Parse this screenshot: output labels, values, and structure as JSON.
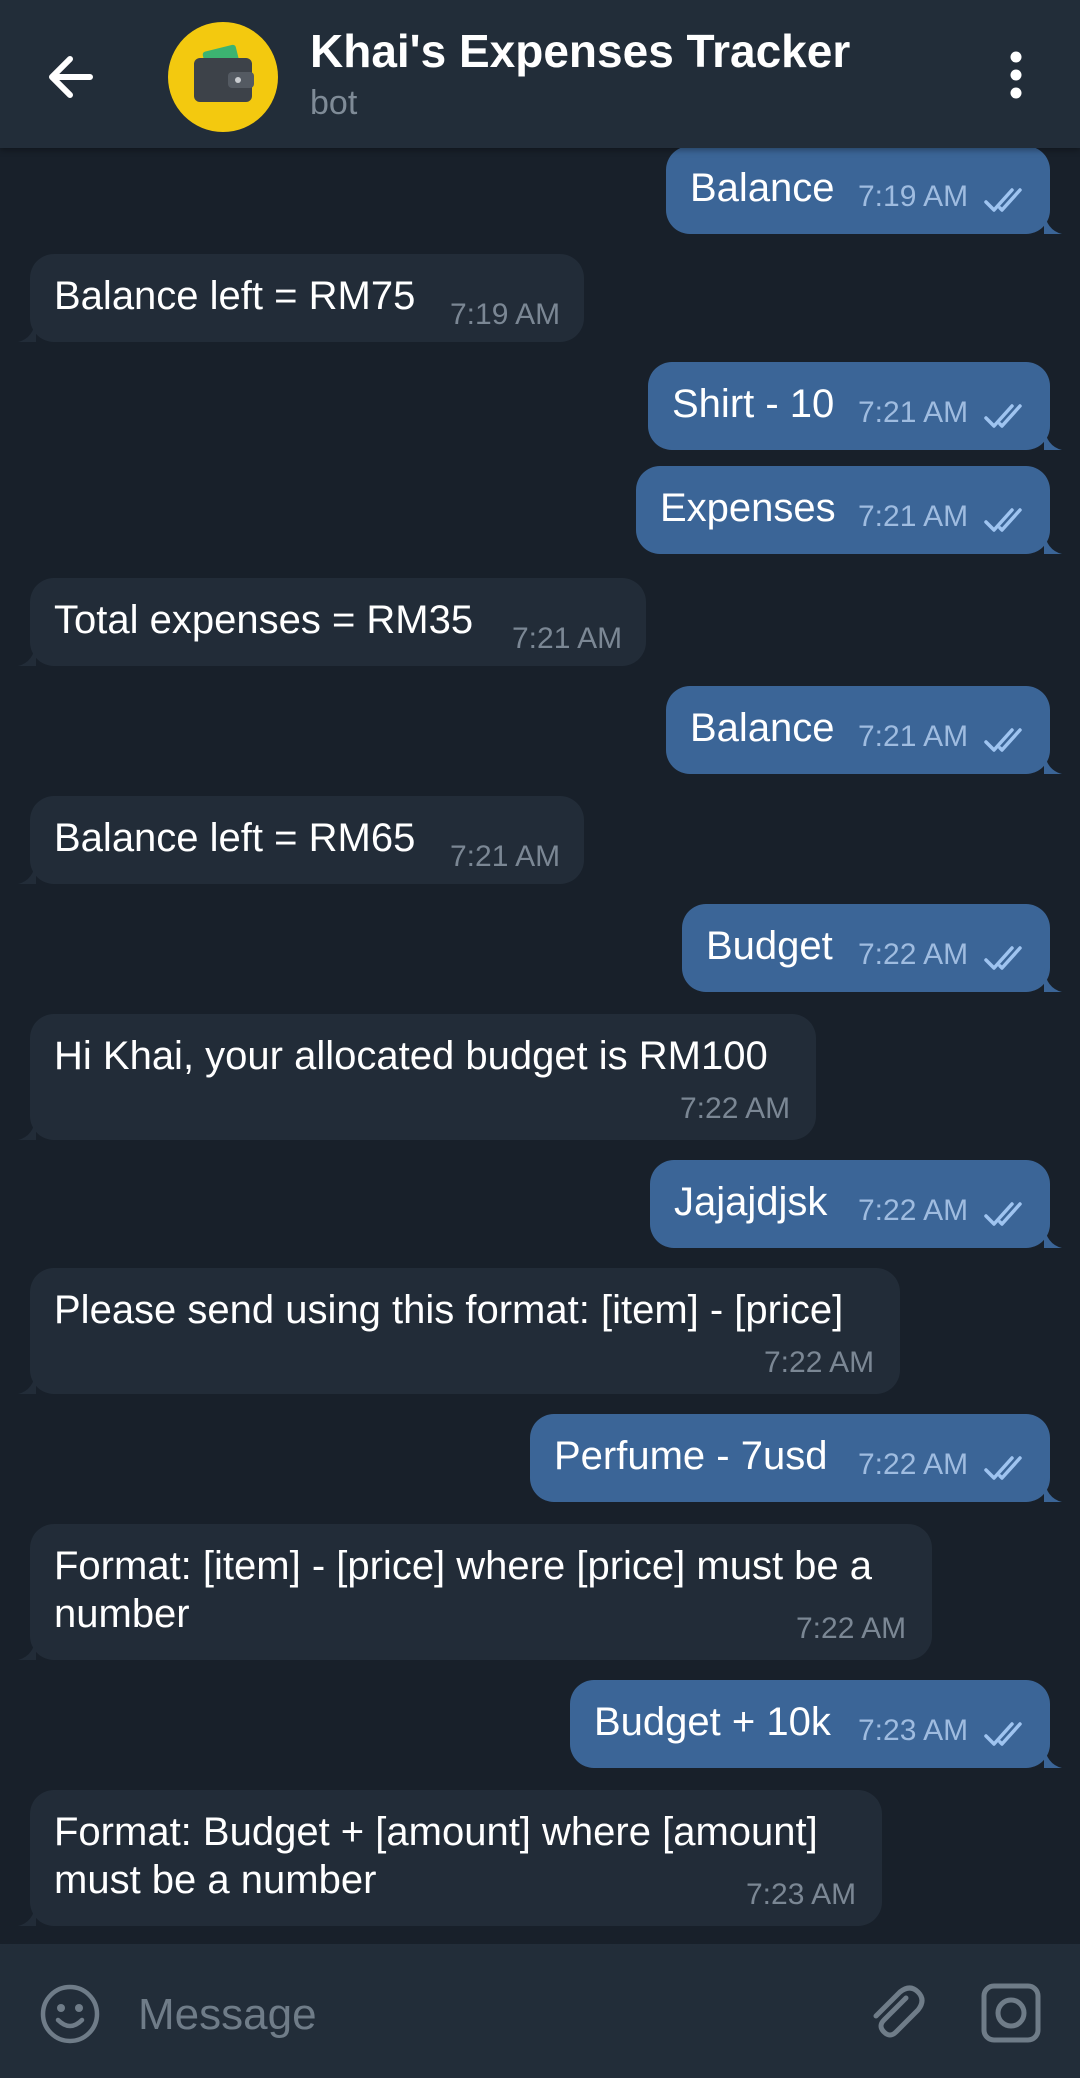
{
  "header": {
    "title": "Khai's Expenses Tracker",
    "subtitle": "bot",
    "back_icon": "arrow-left-icon",
    "avatar_icon": "wallet-icon",
    "menu_icon": "more-vertical-icon"
  },
  "messages": [
    {
      "dir": "out",
      "text": "Balance",
      "time": "7:19 AM"
    },
    {
      "dir": "in",
      "text": "Balance left = RM75",
      "time": "7:19 AM"
    },
    {
      "dir": "out",
      "text": "Shirt - 10",
      "time": "7:21 AM"
    },
    {
      "dir": "out",
      "text": "Expenses",
      "time": "7:21 AM"
    },
    {
      "dir": "in",
      "text": "Total expenses = RM35",
      "time": "7:21 AM"
    },
    {
      "dir": "out",
      "text": "Balance",
      "time": "7:21 AM"
    },
    {
      "dir": "in",
      "text": "Balance left = RM65",
      "time": "7:21 AM"
    },
    {
      "dir": "out",
      "text": "Budget",
      "time": "7:22 AM"
    },
    {
      "dir": "in",
      "text": "Hi Khai, your allocated budget is RM100",
      "time": "7:22 AM"
    },
    {
      "dir": "out",
      "text": "Jajajdjsk",
      "time": "7:22 AM"
    },
    {
      "dir": "in",
      "text": "Please send using this format: [item] - [price]",
      "time": "7:22 AM"
    },
    {
      "dir": "out",
      "text": "Perfume - 7usd",
      "time": "7:22 AM"
    },
    {
      "dir": "in",
      "text": "Format: [item] - [price] where [price] must be a number",
      "time": "7:22 AM"
    },
    {
      "dir": "out",
      "text": "Budget + 10k",
      "time": "7:23 AM"
    },
    {
      "dir": "in",
      "text": "Format: Budget + [amount] where [amount] must be a number",
      "time": "7:23 AM"
    }
  ],
  "composer": {
    "placeholder": "Message",
    "emoji_icon": "emoji-icon",
    "attach_icon": "paperclip-icon",
    "camera_icon": "camera-icon"
  },
  "colors": {
    "background": "#18202a",
    "header": "#222d39",
    "outgoing_bubble": "#3b6597",
    "incoming_bubble": "#222c38",
    "avatar": "#f3c90f"
  }
}
